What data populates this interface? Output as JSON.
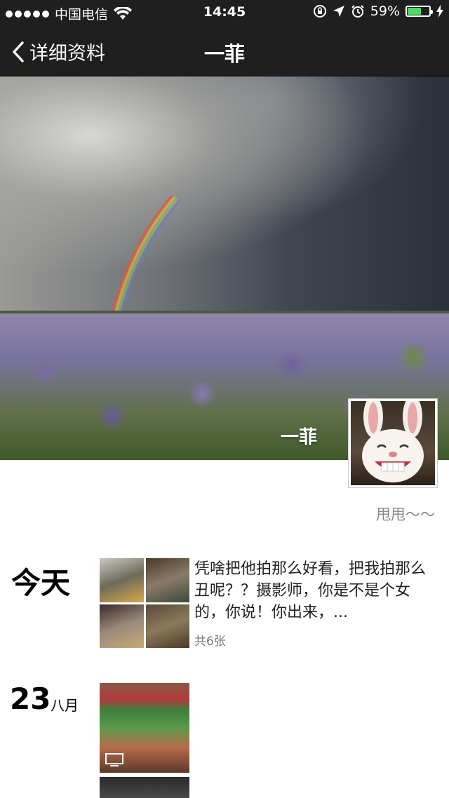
{
  "status_bar": {
    "carrier": "中国电信",
    "time": "14:45",
    "battery": "59%",
    "battery_level": 0.59,
    "icons": [
      "signal-dots-icon",
      "wifi-icon",
      "orientation-lock-icon",
      "location-icon",
      "alarm-icon",
      "battery-icon",
      "charging-icon"
    ]
  },
  "nav": {
    "back_label": "详细资料",
    "title": "一菲"
  },
  "profile": {
    "cover_name": "一菲",
    "signature": "甩甩～～"
  },
  "posts": [
    {
      "date": "今天",
      "text": "凭啥把他拍那么好看，把我拍那么丑呢？？摄影师，你是不是个女的，你说！你出来，...",
      "count": "共6张"
    },
    {
      "day": "23",
      "month": "八月"
    }
  ]
}
